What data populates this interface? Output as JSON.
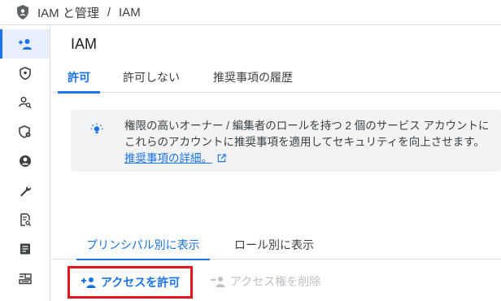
{
  "breadcrumb": {
    "section": "IAM と管理",
    "separator": "/",
    "page": "IAM"
  },
  "sidebar": {
    "items": [
      {
        "icon": "person-add-icon",
        "active": true
      },
      {
        "icon": "shield-icon",
        "active": false
      },
      {
        "icon": "person-search-icon",
        "active": false
      },
      {
        "icon": "shield-settings-icon",
        "active": false
      },
      {
        "icon": "account-circle-icon",
        "active": false
      },
      {
        "icon": "wrench-icon",
        "active": false
      },
      {
        "icon": "document-search-icon",
        "active": false
      },
      {
        "icon": "notes-icon",
        "active": false
      },
      {
        "icon": "id-card-icon",
        "active": false
      }
    ]
  },
  "main": {
    "title": "IAM",
    "tabs": [
      {
        "label": "許可",
        "active": true
      },
      {
        "label": "許可しない",
        "active": false
      },
      {
        "label": "推奨事項の履歴",
        "active": false
      }
    ],
    "banner": {
      "icon": "lightbulb-icon",
      "line1": "権限の高いオーナー / 編集者のロールを持つ 2 個のサービス アカウントに",
      "line2": "これらのアカウントに推奨事項を適用してセキュリティを向上させます。",
      "link": "推奨事項の詳細。"
    },
    "view_tabs": [
      {
        "label": "プリンシパル別に表示",
        "active": true
      },
      {
        "label": "ロール別に表示",
        "active": false
      }
    ],
    "actions": {
      "grant_label": "アクセスを許可",
      "remove_label": "アクセス権を削除"
    }
  },
  "colors": {
    "accent": "#1a73e8",
    "highlight": "#e5141e",
    "disabled": "#bdc1c6"
  }
}
